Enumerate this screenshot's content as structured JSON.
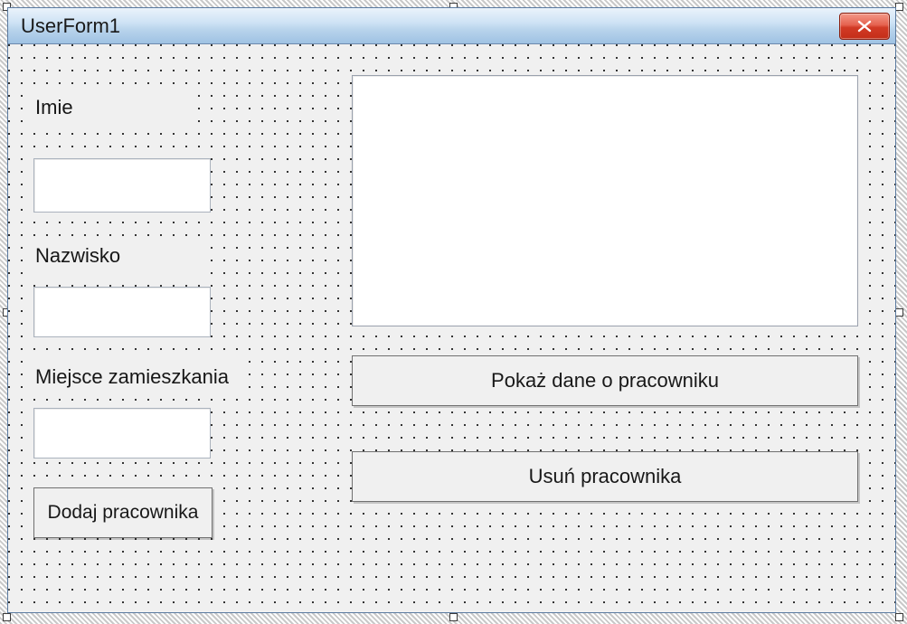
{
  "window": {
    "title": "UserForm1",
    "close_icon": "close-icon"
  },
  "labels": {
    "imie": "Imie",
    "nazwisko": "Nazwisko",
    "miejsce": "Miejsce zamieszkania"
  },
  "inputs": {
    "imie_value": "",
    "nazwisko_value": "",
    "miejsce_value": ""
  },
  "buttons": {
    "add": "Dodaj pracownika",
    "show": "Pokaż dane o pracowniku",
    "delete": "Usuń pracownika"
  },
  "listbox": {
    "items": []
  }
}
